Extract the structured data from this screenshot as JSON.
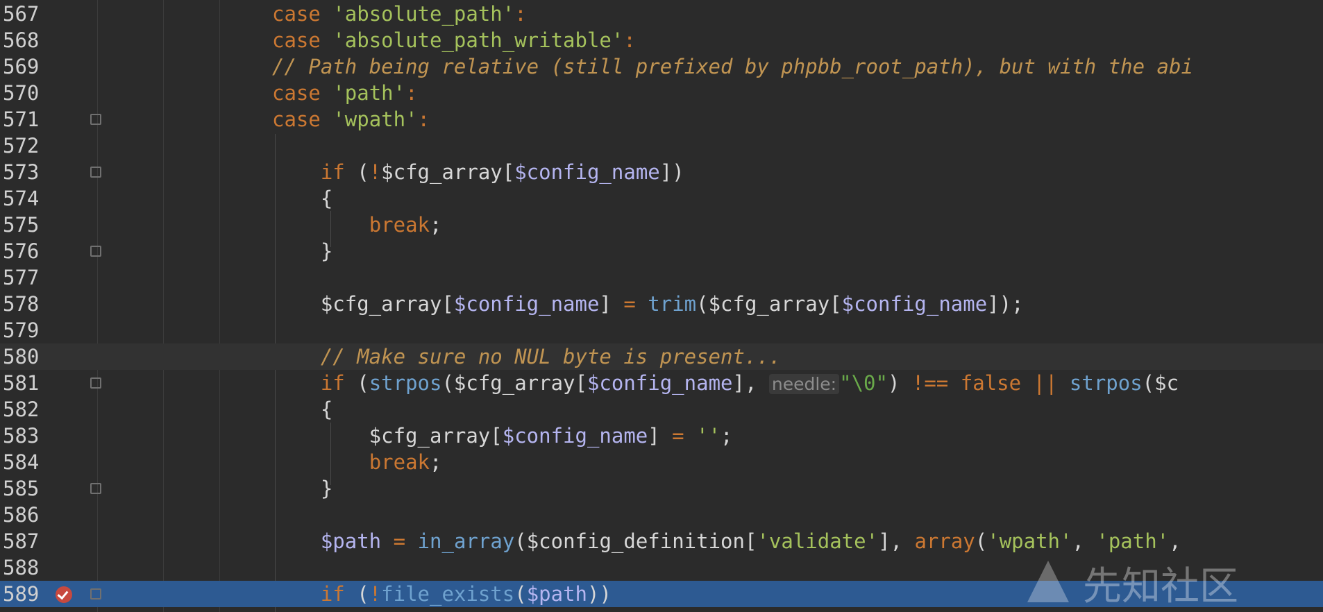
{
  "lines": [
    {
      "num": "567",
      "tokens": [
        {
          "t": "case ",
          "c": "k"
        },
        {
          "t": "'absolute_path'",
          "c": "s"
        },
        {
          "t": ":",
          "c": "k"
        }
      ]
    },
    {
      "num": "568",
      "tokens": [
        {
          "t": "case ",
          "c": "k"
        },
        {
          "t": "'absolute_path_writable'",
          "c": "s"
        },
        {
          "t": ":",
          "c": "k"
        }
      ]
    },
    {
      "num": "569",
      "tokens": [
        {
          "t": "// Path being relative (still prefixed by phpbb_root_path), but with the abi",
          "c": "c"
        }
      ]
    },
    {
      "num": "570",
      "tokens": [
        {
          "t": "case ",
          "c": "k"
        },
        {
          "t": "'path'",
          "c": "s"
        },
        {
          "t": ":",
          "c": "k"
        }
      ]
    },
    {
      "num": "571",
      "tokens": [
        {
          "t": "case ",
          "c": "k"
        },
        {
          "t": "'wpath'",
          "c": "s"
        },
        {
          "t": ":",
          "c": "k"
        }
      ]
    },
    {
      "num": "572",
      "tokens": []
    },
    {
      "num": "573",
      "tokens": [
        {
          "t": "    "
        },
        {
          "t": "if",
          "c": "k"
        },
        {
          "t": " ("
        },
        {
          "t": "!",
          "c": "k"
        },
        {
          "t": "$cfg_array["
        },
        {
          "t": "$config_name",
          "c": "v"
        },
        {
          "t": "])"
        }
      ]
    },
    {
      "num": "574",
      "tokens": [
        {
          "t": "    {"
        }
      ]
    },
    {
      "num": "575",
      "tokens": [
        {
          "t": "        "
        },
        {
          "t": "break",
          "c": "k"
        },
        {
          "t": ";"
        }
      ]
    },
    {
      "num": "576",
      "tokens": [
        {
          "t": "    }"
        }
      ]
    },
    {
      "num": "577",
      "tokens": []
    },
    {
      "num": "578",
      "tokens": [
        {
          "t": "    $cfg_array["
        },
        {
          "t": "$config_name",
          "c": "v"
        },
        {
          "t": "] "
        },
        {
          "t": "=",
          "c": "k"
        },
        {
          "t": " "
        },
        {
          "t": "trim",
          "c": "f"
        },
        {
          "t": "($cfg_array["
        },
        {
          "t": "$config_name",
          "c": "v"
        },
        {
          "t": "]);"
        }
      ]
    },
    {
      "num": "579",
      "tokens": []
    },
    {
      "num": "580",
      "tokens": [
        {
          "t": "    "
        },
        {
          "t": "// Make sure no NUL byte is present...",
          "c": "c"
        }
      ]
    },
    {
      "num": "581",
      "tokens": [
        {
          "t": "    "
        },
        {
          "t": "if",
          "c": "k"
        },
        {
          "t": " ("
        },
        {
          "t": "strpos",
          "c": "f"
        },
        {
          "t": "($cfg_array["
        },
        {
          "t": "$config_name",
          "c": "v"
        },
        {
          "t": "], "
        },
        {
          "t": "needle:",
          "c": "hint"
        },
        {
          "t": "\"\\0\"",
          "c": "g"
        },
        {
          "t": ") "
        },
        {
          "t": "!==",
          "c": "k"
        },
        {
          "t": " "
        },
        {
          "t": "false",
          "c": "k"
        },
        {
          "t": " "
        },
        {
          "t": "||",
          "c": "k"
        },
        {
          "t": " "
        },
        {
          "t": "strpos",
          "c": "f"
        },
        {
          "t": "($c"
        }
      ]
    },
    {
      "num": "582",
      "tokens": [
        {
          "t": "    {"
        }
      ]
    },
    {
      "num": "583",
      "tokens": [
        {
          "t": "        $cfg_array["
        },
        {
          "t": "$config_name",
          "c": "v"
        },
        {
          "t": "] "
        },
        {
          "t": "=",
          "c": "k"
        },
        {
          "t": " "
        },
        {
          "t": "''",
          "c": "s"
        },
        {
          "t": ";"
        }
      ]
    },
    {
      "num": "584",
      "tokens": [
        {
          "t": "        "
        },
        {
          "t": "break",
          "c": "k"
        },
        {
          "t": ";"
        }
      ]
    },
    {
      "num": "585",
      "tokens": [
        {
          "t": "    }"
        }
      ]
    },
    {
      "num": "586",
      "tokens": []
    },
    {
      "num": "587",
      "tokens": [
        {
          "t": "    "
        },
        {
          "t": "$path",
          "c": "v"
        },
        {
          "t": " "
        },
        {
          "t": "=",
          "c": "k"
        },
        {
          "t": " "
        },
        {
          "t": "in_array",
          "c": "f"
        },
        {
          "t": "($config_definition["
        },
        {
          "t": "'validate'",
          "c": "s"
        },
        {
          "t": "], "
        },
        {
          "t": "array",
          "c": "k"
        },
        {
          "t": "("
        },
        {
          "t": "'wpath'",
          "c": "s"
        },
        {
          "t": ", "
        },
        {
          "t": "'path'",
          "c": "s"
        },
        {
          "t": ","
        }
      ]
    },
    {
      "num": "588",
      "tokens": []
    },
    {
      "num": "589",
      "tokens": [
        {
          "t": "    "
        },
        {
          "t": "if",
          "c": "k"
        },
        {
          "t": " ("
        },
        {
          "t": "!",
          "c": "k"
        },
        {
          "t": "file_exists",
          "c": "f"
        },
        {
          "t": "("
        },
        {
          "t": "$path",
          "c": "v"
        },
        {
          "t": "))"
        }
      ]
    }
  ],
  "fold_markers": [
    "571",
    "573",
    "576",
    "581",
    "585",
    "589"
  ],
  "breakpoint_line": "589",
  "current_line": "580",
  "selected_line": "589",
  "watermark": "先知社区",
  "watermark_icon": "xianzhi-logo-icon",
  "breakpoint_icon": "breakpoint-check-icon",
  "fold_icon": "fold-marker-icon",
  "colors": {
    "background": "#2b2b2b",
    "keyword": "#cc7832",
    "string": "#a5c25c",
    "comment": "#c09452",
    "variable": "#b5b5f0",
    "function": "#6fa2cf",
    "selection": "#2d5a92",
    "breakpoint": "#c7493f"
  }
}
